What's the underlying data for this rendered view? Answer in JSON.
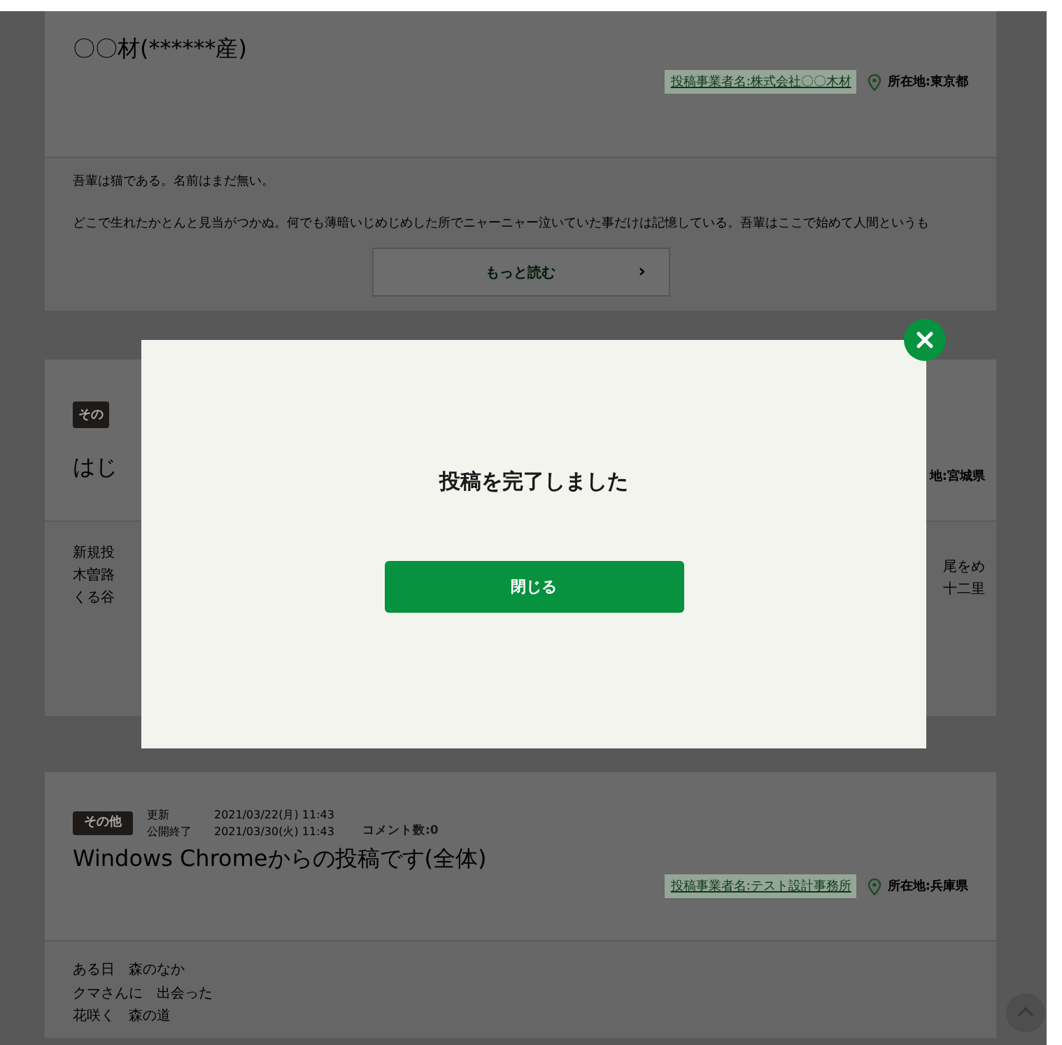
{
  "posts": [
    {
      "kind": "full",
      "title": "〇〇材(******産)",
      "company": "投稿事業者名:株式会社〇〇木材",
      "location": "所在地:東京都",
      "body": [
        "吾輩は猫である。名前はまだ無い。",
        "どこで生れたかとんと見当がつかぬ。何でも薄暗いじめじめした所でニャーニャー泣いていた事だけは記憶している。吾輩はここで始めて人間というも"
      ],
      "more_button": {
        "label": "もっと読む",
        "arrow": "›"
      }
    },
    {
      "kind": "covered",
      "category": "その",
      "title": "はじ",
      "location": "地:宮城県",
      "body_left": [
        "新規投",
        "木曽路",
        "くる谷"
      ],
      "body_right": [
        "尾をめ",
        "十二里"
      ]
    },
    {
      "kind": "compact",
      "category": "その他",
      "updated_label": "更新",
      "updated": "2021/03/22(月) 11:43",
      "ends_label": "公開終了",
      "ends": "2021/03/30(火) 11:43",
      "comments": "コメント数:0",
      "title": "Windows Chromeからの投稿です(全体)",
      "company": "投稿事業者名:テスト設計事務所",
      "location": "所在地:兵庫県",
      "body": [
        "ある日　森のなか",
        "クマさんに　出会った",
        "花咲く　森の道"
      ]
    }
  ],
  "modal": {
    "message": "投稿を完了しました",
    "button": "閉じる"
  }
}
